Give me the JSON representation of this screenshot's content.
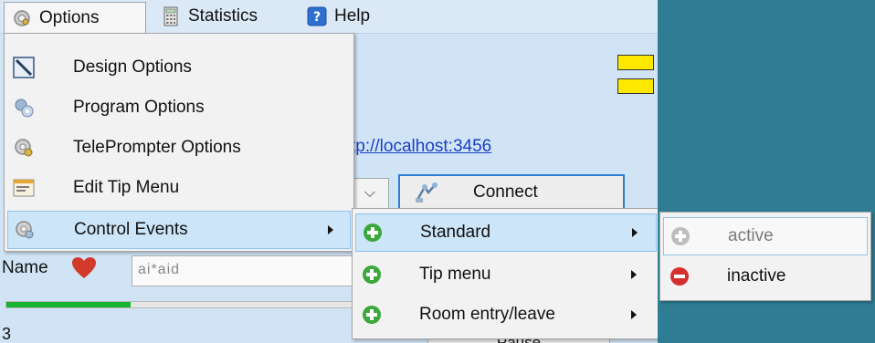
{
  "menubar": {
    "options": "Options",
    "statistics": "Statistics",
    "help": "Help"
  },
  "background": {
    "url": "tp://localhost:3456",
    "connect": "Connect",
    "name_label": "Name",
    "name_value": "ai*aid",
    "progress": 0.35,
    "count": "3",
    "pause": "Pause"
  },
  "options_menu": {
    "items": [
      {
        "label": "Design Options",
        "icon": "design-icon"
      },
      {
        "label": "Program Options",
        "icon": "program-icon"
      },
      {
        "label": "TelePrompter Options",
        "icon": "teleprompter-icon"
      },
      {
        "label": "Edit Tip Menu",
        "icon": "tip-menu-icon"
      },
      {
        "label": "Control Events",
        "icon": "control-events-icon"
      }
    ]
  },
  "events_menu": {
    "items": [
      {
        "label": "Standard",
        "icon": "plus-circle-icon"
      },
      {
        "label": "Tip menu",
        "icon": "plus-circle-icon"
      },
      {
        "label": "Room entry/leave",
        "icon": "plus-circle-icon"
      }
    ]
  },
  "state_menu": {
    "items": [
      {
        "label": "active",
        "icon": "plus-circle-disabled-icon"
      },
      {
        "label": "inactive",
        "icon": "minus-circle-icon"
      }
    ]
  },
  "colors": {
    "accent": "#2a7fd4",
    "highlight": "#cde5f8",
    "progress": "#17b22f",
    "desktop": "#2f7d94"
  }
}
